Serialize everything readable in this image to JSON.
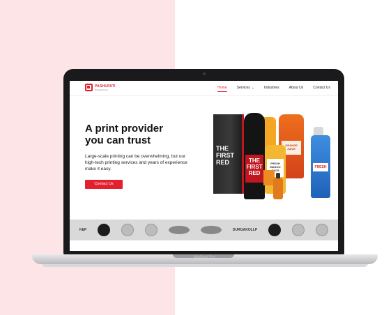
{
  "device": {
    "label": "MacBook Pro"
  },
  "nav": {
    "brand": "PASHUPATI",
    "tagline": "Printing Press",
    "items": [
      {
        "label": "Home",
        "active": true
      },
      {
        "label": "Services",
        "has_dropdown": true
      },
      {
        "label": "Industries"
      },
      {
        "label": "About Us"
      },
      {
        "label": "Contact Us"
      }
    ]
  },
  "hero": {
    "title": "A print provider you can trust",
    "body": "Large-scale printing can be overwhelming, but our high-tech printing services and years of experience make it easy.",
    "cta_label": "Contact Us"
  },
  "products": {
    "box_text": "THE FIRST RED",
    "wine_text": "THE FIRST RED",
    "juice_text": "FRESH MANGO JUICE",
    "orange_text": "ORANGE JUICE",
    "spray_text": "FRESH"
  },
  "clients": [
    {
      "kind": "text",
      "label": "KEP"
    },
    {
      "kind": "circle-dark"
    },
    {
      "kind": "circle-light"
    },
    {
      "kind": "circle-light"
    },
    {
      "kind": "oval"
    },
    {
      "kind": "oval"
    },
    {
      "kind": "text",
      "label": "DURGAKOLLP"
    },
    {
      "kind": "circle-dark"
    },
    {
      "kind": "circle-light"
    },
    {
      "kind": "circle-light"
    }
  ],
  "colors": {
    "accent": "#e41f2f",
    "background_left": "#fde4e6",
    "strip": "#d9d9d9"
  }
}
